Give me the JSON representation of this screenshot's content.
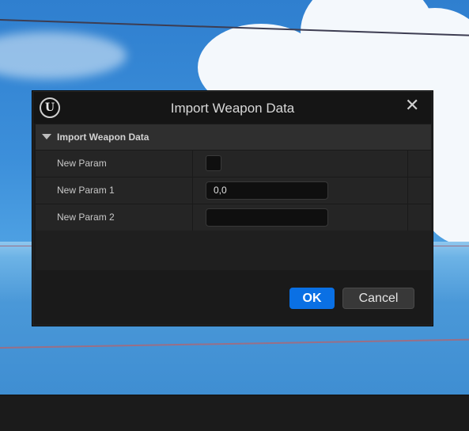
{
  "dialog": {
    "title": "Import Weapon Data",
    "section_label": "Import Weapon Data",
    "rows": [
      {
        "label": "New Param",
        "type": "checkbox",
        "checked": false
      },
      {
        "label": "New Param 1",
        "type": "text",
        "value": "0,0"
      },
      {
        "label": "New Param 2",
        "type": "text",
        "value": ""
      }
    ],
    "ok_label": "OK",
    "cancel_label": "Cancel",
    "logo_glyph": "U",
    "close_glyph": "✕"
  },
  "colors": {
    "accent": "#0a70e4",
    "dialog_bg": "#1a1a1a"
  },
  "icons": [
    "unreal-engine-logo-icon",
    "close-icon",
    "collapse-arrow-icon"
  ]
}
